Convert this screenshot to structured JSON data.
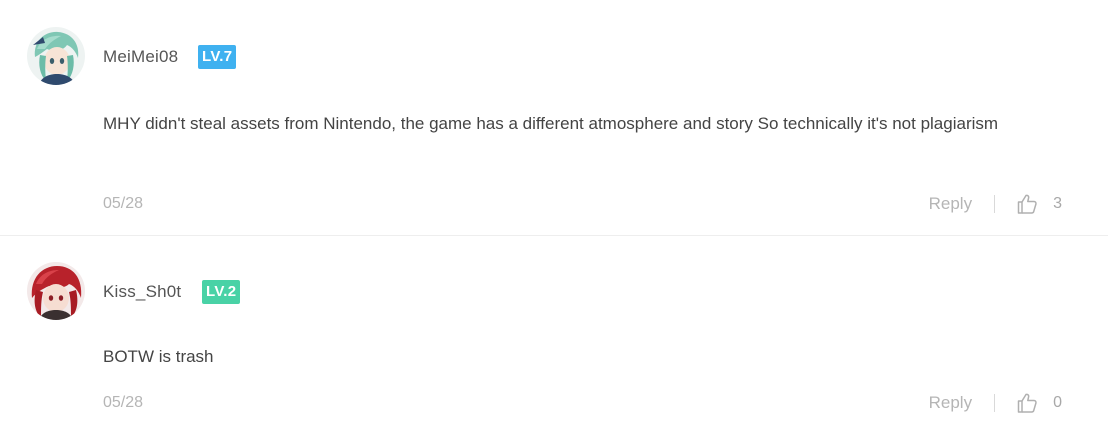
{
  "colors": {
    "lv7_badge": "#3fb1f0",
    "lv2_badge": "#49d2a6",
    "muted_text": "#b5b5b5",
    "body_text": "#444444"
  },
  "comments": [
    {
      "username": "MeiMei08",
      "level": "LV.7",
      "text": "MHY didn't steal assets from Nintendo, the game has a different atmosphere and story  So technically it's not plagiarism",
      "date": "05/28",
      "reply_label": "Reply",
      "like_icon": "thumbs-up-icon",
      "likes": "3"
    },
    {
      "username": "Kiss_Sh0t",
      "level": "LV.2",
      "text": "BOTW is trash",
      "date": "05/28",
      "reply_label": "Reply",
      "like_icon": "thumbs-up-icon",
      "likes": "0"
    }
  ]
}
